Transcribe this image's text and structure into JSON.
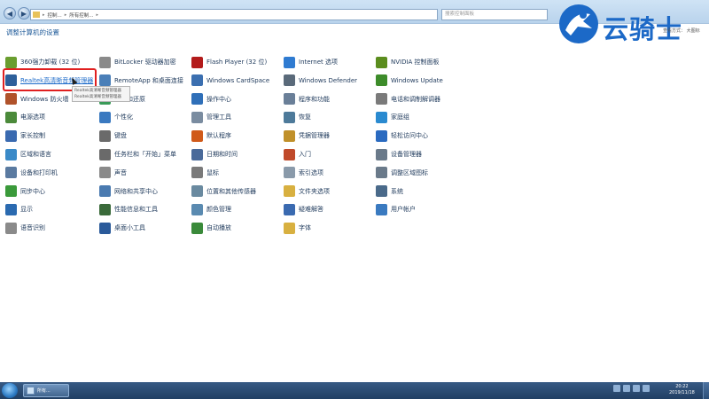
{
  "window": {
    "address_segments": [
      "控制...",
      "所有控制...",
      ""
    ],
    "search_placeholder": "搜索控制面板"
  },
  "page": {
    "title": "调整计算机的设置",
    "view_by": "查看方式： 大图标"
  },
  "brand": {
    "text": "云骑士"
  },
  "items": [
    {
      "label": "360强力卸载 (32 位)",
      "icon": "uninstall-icon",
      "color": "#6a9e2f"
    },
    {
      "label": "BitLocker 驱动器加密",
      "icon": "bitlocker-icon",
      "color": "#8a8a8a"
    },
    {
      "label": "Flash Player (32 位)",
      "icon": "flash-icon",
      "color": "#b31b1b"
    },
    {
      "label": "Internet 选项",
      "icon": "internet-icon",
      "color": "#2f7bd1"
    },
    {
      "label": "NVIDIA 控制面板",
      "icon": "nvidia-icon",
      "color": "#5b8d1e"
    },
    {
      "label": "Realtek高清晰音频管理器",
      "icon": "audio-manager-icon",
      "color": "#2d5f9a"
    },
    {
      "label": "RemoteApp 和桌面连接",
      "icon": "remoteapp-icon",
      "color": "#4a7fb8"
    },
    {
      "label": "Windows CardSpace",
      "icon": "cardspace-icon",
      "color": "#3b6fb0"
    },
    {
      "label": "Windows Defender",
      "icon": "defender-icon",
      "color": "#5a6a7a"
    },
    {
      "label": "Windows Update",
      "icon": "windows-update-icon",
      "color": "#3d8c2a"
    },
    {
      "label": "Windows 防火墙",
      "icon": "firewall-icon",
      "color": "#b0522a"
    },
    {
      "label": "备份和还原",
      "icon": "backup-icon",
      "color": "#3a9a58"
    },
    {
      "label": "操作中心",
      "icon": "flag-icon",
      "color": "#2f6fb8"
    },
    {
      "label": "程序和功能",
      "icon": "programs-icon",
      "color": "#6a7f98"
    },
    {
      "label": "电话和调制解调器",
      "icon": "phone-icon",
      "color": "#7a7a7a"
    },
    {
      "label": "电源选项",
      "icon": "power-icon",
      "color": "#4b8a3a"
    },
    {
      "label": "个性化",
      "icon": "personalize-icon",
      "color": "#3a79c0"
    },
    {
      "label": "管理工具",
      "icon": "admin-tools-icon",
      "color": "#7a8ca0"
    },
    {
      "label": "恢复",
      "icon": "recovery-icon",
      "color": "#4d7a9a"
    },
    {
      "label": "家庭组",
      "icon": "homegroup-icon",
      "color": "#2a8ad0"
    },
    {
      "label": "家长控制",
      "icon": "parental-icon",
      "color": "#3a6ab0"
    },
    {
      "label": "键盘",
      "icon": "keyboard-icon",
      "color": "#6a6a6a"
    },
    {
      "label": "默认程序",
      "icon": "default-programs-icon",
      "color": "#d05a1a"
    },
    {
      "label": "凭据管理器",
      "icon": "credential-icon",
      "color": "#c0902a"
    },
    {
      "label": "轻松访问中心",
      "icon": "ease-access-icon",
      "color": "#2a6ac0"
    },
    {
      "label": "区域和语言",
      "icon": "region-icon",
      "color": "#3a8ac8"
    },
    {
      "label": "任务栏和「开始」菜单",
      "icon": "taskbar-icon",
      "color": "#6a6a6a"
    },
    {
      "label": "日期和时间",
      "icon": "clock-icon",
      "color": "#4a6a9a"
    },
    {
      "label": "入门",
      "icon": "getting-started-icon",
      "color": "#c04a2a"
    },
    {
      "label": "设备管理器",
      "icon": "device-manager-icon",
      "color": "#6a7a8a"
    },
    {
      "label": "设备和打印机",
      "icon": "printer-icon",
      "color": "#5a7aa0"
    },
    {
      "label": "声音",
      "icon": "sound-icon",
      "color": "#8a8a8a"
    },
    {
      "label": "鼠标",
      "icon": "mouse-icon",
      "color": "#7a7a7a"
    },
    {
      "label": "索引选项",
      "icon": "index-icon",
      "color": "#8a9aaa"
    },
    {
      "label": "调整区域图标",
      "icon": "notify-icons-icon",
      "color": "#6a7a8a"
    },
    {
      "label": "同步中心",
      "icon": "sync-icon",
      "color": "#3a9a3a"
    },
    {
      "label": "网络和共享中心",
      "icon": "network-icon",
      "color": "#4a7ab0"
    },
    {
      "label": "位置和其他传感器",
      "icon": "sensor-icon",
      "color": "#6a8aa0"
    },
    {
      "label": "文件夹选项",
      "icon": "folder-icon",
      "color": "#d8b040"
    },
    {
      "label": "系统",
      "icon": "system-icon",
      "color": "#4a6a8a"
    },
    {
      "label": "显示",
      "icon": "display-icon",
      "color": "#2a6ab0"
    },
    {
      "label": "性能信息和工具",
      "icon": "performance-icon",
      "color": "#3a6a3a"
    },
    {
      "label": "颜色管理",
      "icon": "color-icon",
      "color": "#5a8ab0"
    },
    {
      "label": "疑难解答",
      "icon": "troubleshoot-icon",
      "color": "#3a6ab0"
    },
    {
      "label": "用户帐户",
      "icon": "user-accounts-icon",
      "color": "#3a7ac0"
    },
    {
      "label": "语音识别",
      "icon": "microphone-icon",
      "color": "#8a8a8a"
    },
    {
      "label": "桌面小工具",
      "icon": "gadgets-icon",
      "color": "#2a5a9a"
    },
    {
      "label": "自动播放",
      "icon": "autoplay-icon",
      "color": "#3a8a3a"
    },
    {
      "label": "字体",
      "icon": "font-icon",
      "color": "#d8b040"
    }
  ],
  "tooltip": {
    "line1": "Realtek高清晰音频管理器",
    "line2": "Realtek高清晰音频管理器"
  },
  "taskbar": {
    "task_label": "所有...",
    "time": "20:22",
    "date": "2019/11/18"
  }
}
